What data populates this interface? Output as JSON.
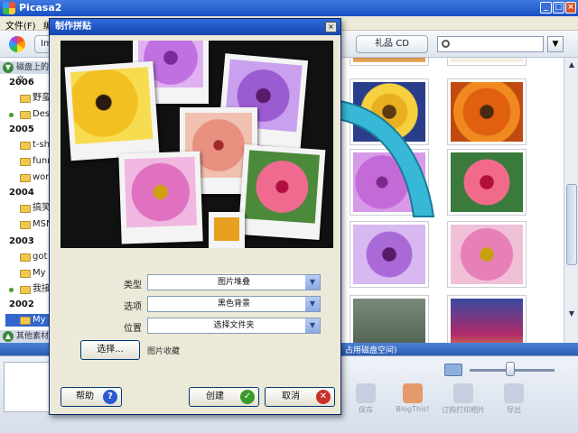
{
  "app": {
    "title": "Picasa2",
    "menu": [
      "文件(F)",
      "编"
    ],
    "toolbar_tab": "Im",
    "gift_cd": "礼品 CD",
    "search_placeholder": ""
  },
  "sidebar": {
    "header": "磁盘上的文",
    "footer": "其他素材",
    "groups": [
      {
        "year": "2006",
        "folders": [
          "野蛮",
          "Desk"
        ]
      },
      {
        "year": "2005",
        "folders": [
          "t-shi",
          "funn",
          "work"
        ]
      },
      {
        "year": "2004",
        "folders": [
          "搞笑",
          "MSN"
        ]
      },
      {
        "year": "2003",
        "folders": [
          "got",
          "My F",
          "我接"
        ]
      },
      {
        "year": "2002",
        "folders": [
          "My F"
        ]
      }
    ]
  },
  "status": {
    "right": "占用磁盘空间)"
  },
  "bottom_buttons": [
    "保存",
    "BlogThis!",
    "订购打印相片",
    "导出"
  ],
  "dialog": {
    "title": "制作拼贴",
    "type_label": "类型",
    "type_value": "图片堆叠",
    "option_label": "选项",
    "option_value": "黑色背景",
    "location_label": "位置",
    "location_value": "选择文件夹",
    "choose_button": "选择...",
    "collection_text": "图片收藏",
    "help_button": "帮助",
    "create_button": "创建",
    "cancel_button": "取消"
  },
  "colors": {
    "title_blue": "#1a4fc4",
    "dialog_bg": "#ece9d8",
    "arrow_teal": "#36b8d6"
  }
}
